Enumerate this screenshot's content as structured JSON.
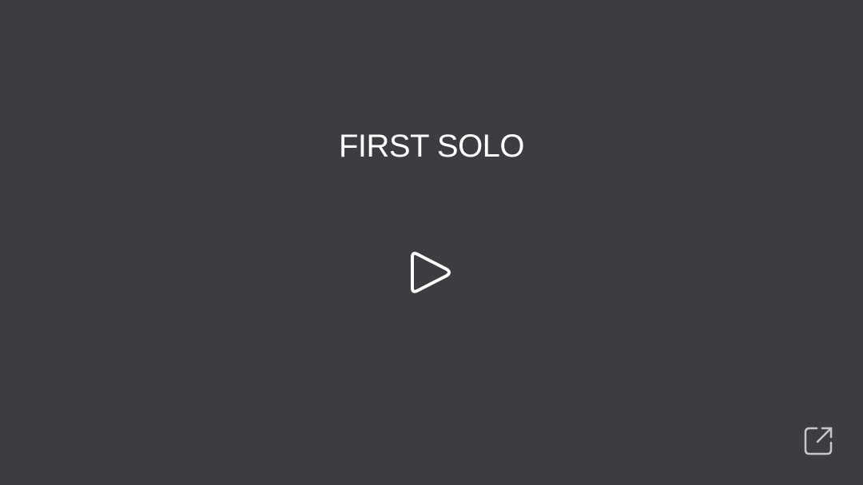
{
  "video": {
    "title": "FIRST SOLO"
  },
  "controls": {
    "play_icon": "play-icon",
    "share_icon": "external-link-icon"
  },
  "colors": {
    "background": "#3c3d41",
    "text": "#ffffff",
    "share_icon": "#c8c8c8"
  }
}
